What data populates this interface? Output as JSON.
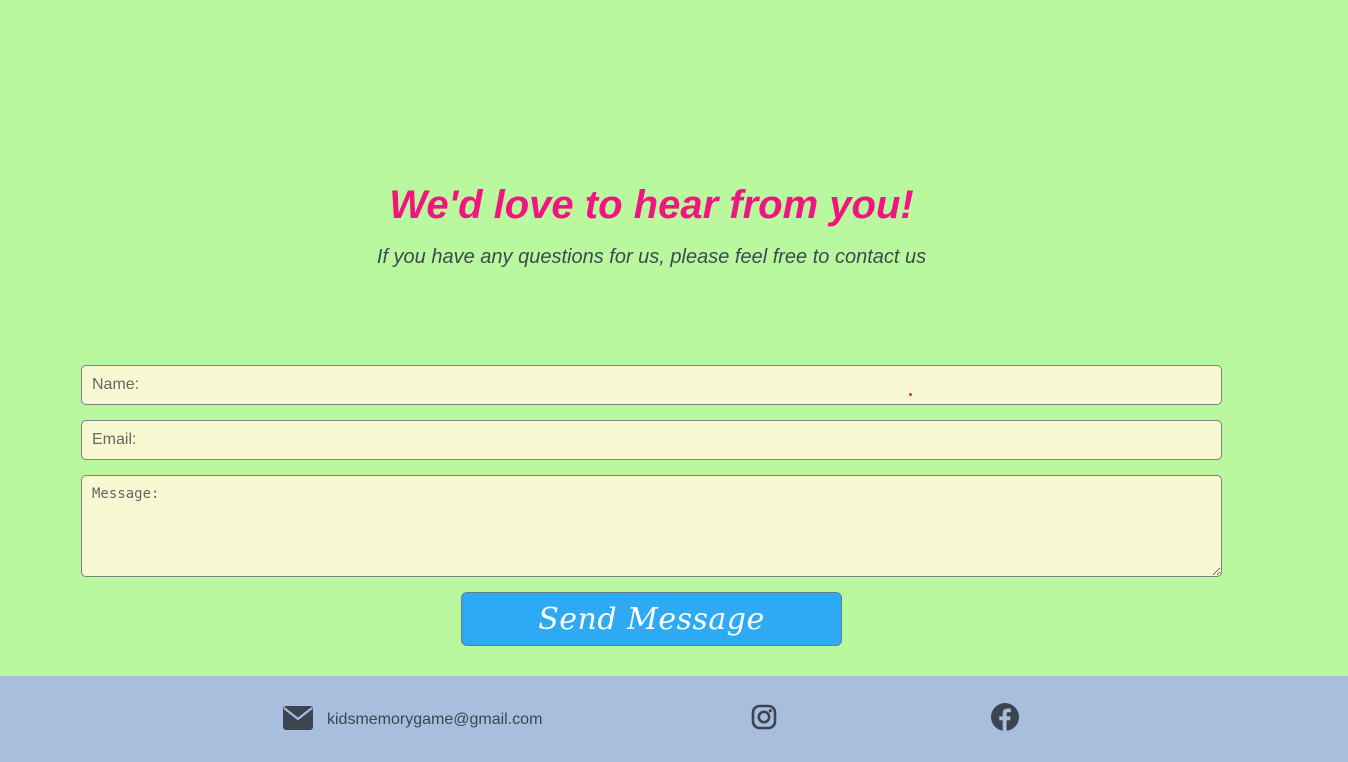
{
  "contact": {
    "heading": "We'd love to hear from you!",
    "subheading": "If you have any questions for us, please feel free to contact us"
  },
  "form": {
    "name_placeholder": "Name:",
    "email_placeholder": "Email:",
    "message_placeholder": "Message:",
    "send_label": "Send Message"
  },
  "footer": {
    "email": "kidsmemorygame@gmail.com",
    "icons": [
      "envelope-icon",
      "instagram-icon",
      "facebook-icon"
    ]
  },
  "colors": {
    "background": "#baf8a0",
    "heading": "#f2157f",
    "button": "#2eaaf5",
    "field": "#f8f9d2",
    "footer": "#a9bddc"
  }
}
